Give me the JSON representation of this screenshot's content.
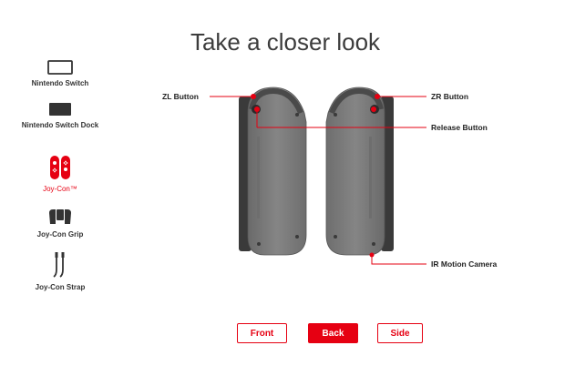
{
  "page": {
    "title": "Take a closer look"
  },
  "sidebar": {
    "items": [
      {
        "label": "Nintendo Switch",
        "icon": "console-outline-icon",
        "active": false
      },
      {
        "label": "Nintendo Switch Dock",
        "icon": "dock-icon",
        "active": false
      },
      {
        "label": "Joy-Con™",
        "icon": "joycon-icon",
        "active": true
      },
      {
        "label": "Joy-Con Grip",
        "icon": "grip-icon",
        "active": false
      },
      {
        "label": "Joy-Con Strap",
        "icon": "strap-icon",
        "active": false
      }
    ]
  },
  "callouts": {
    "zl": "ZL Button",
    "zr": "ZR Button",
    "release": "Release Button",
    "ir": "IR Motion Camera"
  },
  "views": {
    "front": "Front",
    "back": "Back",
    "side": "Side",
    "selected": "Back"
  },
  "colors": {
    "accent": "#e60012",
    "controller_body": "#7b7b7b",
    "rail": "#3a3a3a"
  }
}
